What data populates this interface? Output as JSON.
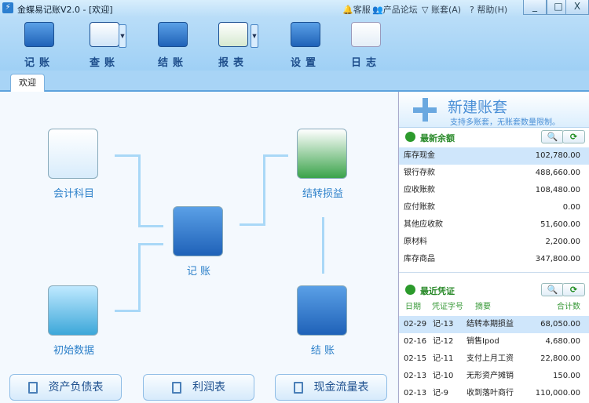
{
  "title": "金蝶易记账V2.0 - [欢迎]",
  "top_links": {
    "service": "客服",
    "forum": "产品论坛",
    "account": "账套(A)",
    "help": "帮助(H)"
  },
  "toolbar": [
    {
      "label": "记账"
    },
    {
      "label": "查账"
    },
    {
      "label": "结账"
    },
    {
      "label": "报表"
    },
    {
      "label": "设置"
    },
    {
      "label": "日志"
    }
  ],
  "tab": "欢迎",
  "flow": {
    "accounts": "会计科目",
    "init": "初始数据",
    "entry": "记 账",
    "transfer": "结转损益",
    "close": "结 账"
  },
  "reports": [
    "资产负债表",
    "利润表",
    "现金流量表"
  ],
  "new_account": {
    "title": "新建账套",
    "subtitle": "支持多账套，无账套数量限制。"
  },
  "balances": {
    "title": "最新余额",
    "rows": [
      {
        "name": "库存现金",
        "amount": "102,780.00"
      },
      {
        "name": "银行存款",
        "amount": "488,660.00"
      },
      {
        "name": "应收账款",
        "amount": "108,480.00"
      },
      {
        "name": "应付账款",
        "amount": "0.00"
      },
      {
        "name": "其他应收款",
        "amount": "51,600.00"
      },
      {
        "name": "原材料",
        "amount": "2,200.00"
      },
      {
        "name": "库存商品",
        "amount": "347,800.00"
      }
    ]
  },
  "vouchers": {
    "title": "最近凭证",
    "headers": {
      "date": "日期",
      "no": "凭证字号",
      "summary": "摘要",
      "total": "合计数"
    },
    "rows": [
      {
        "date": "02-29",
        "no": "记-13",
        "summary": "结转本期损益",
        "total": "68,050.00"
      },
      {
        "date": "02-16",
        "no": "记-12",
        "summary": "销售Ipod",
        "total": "4,680.00"
      },
      {
        "date": "02-15",
        "no": "记-11",
        "summary": "支付上月工资",
        "total": "22,800.00"
      },
      {
        "date": "02-13",
        "no": "记-10",
        "summary": "无形资产摊销",
        "total": "150.00"
      },
      {
        "date": "02-13",
        "no": "记-9",
        "summary": "收到落叶商行",
        "total": "110,000.00"
      }
    ]
  }
}
